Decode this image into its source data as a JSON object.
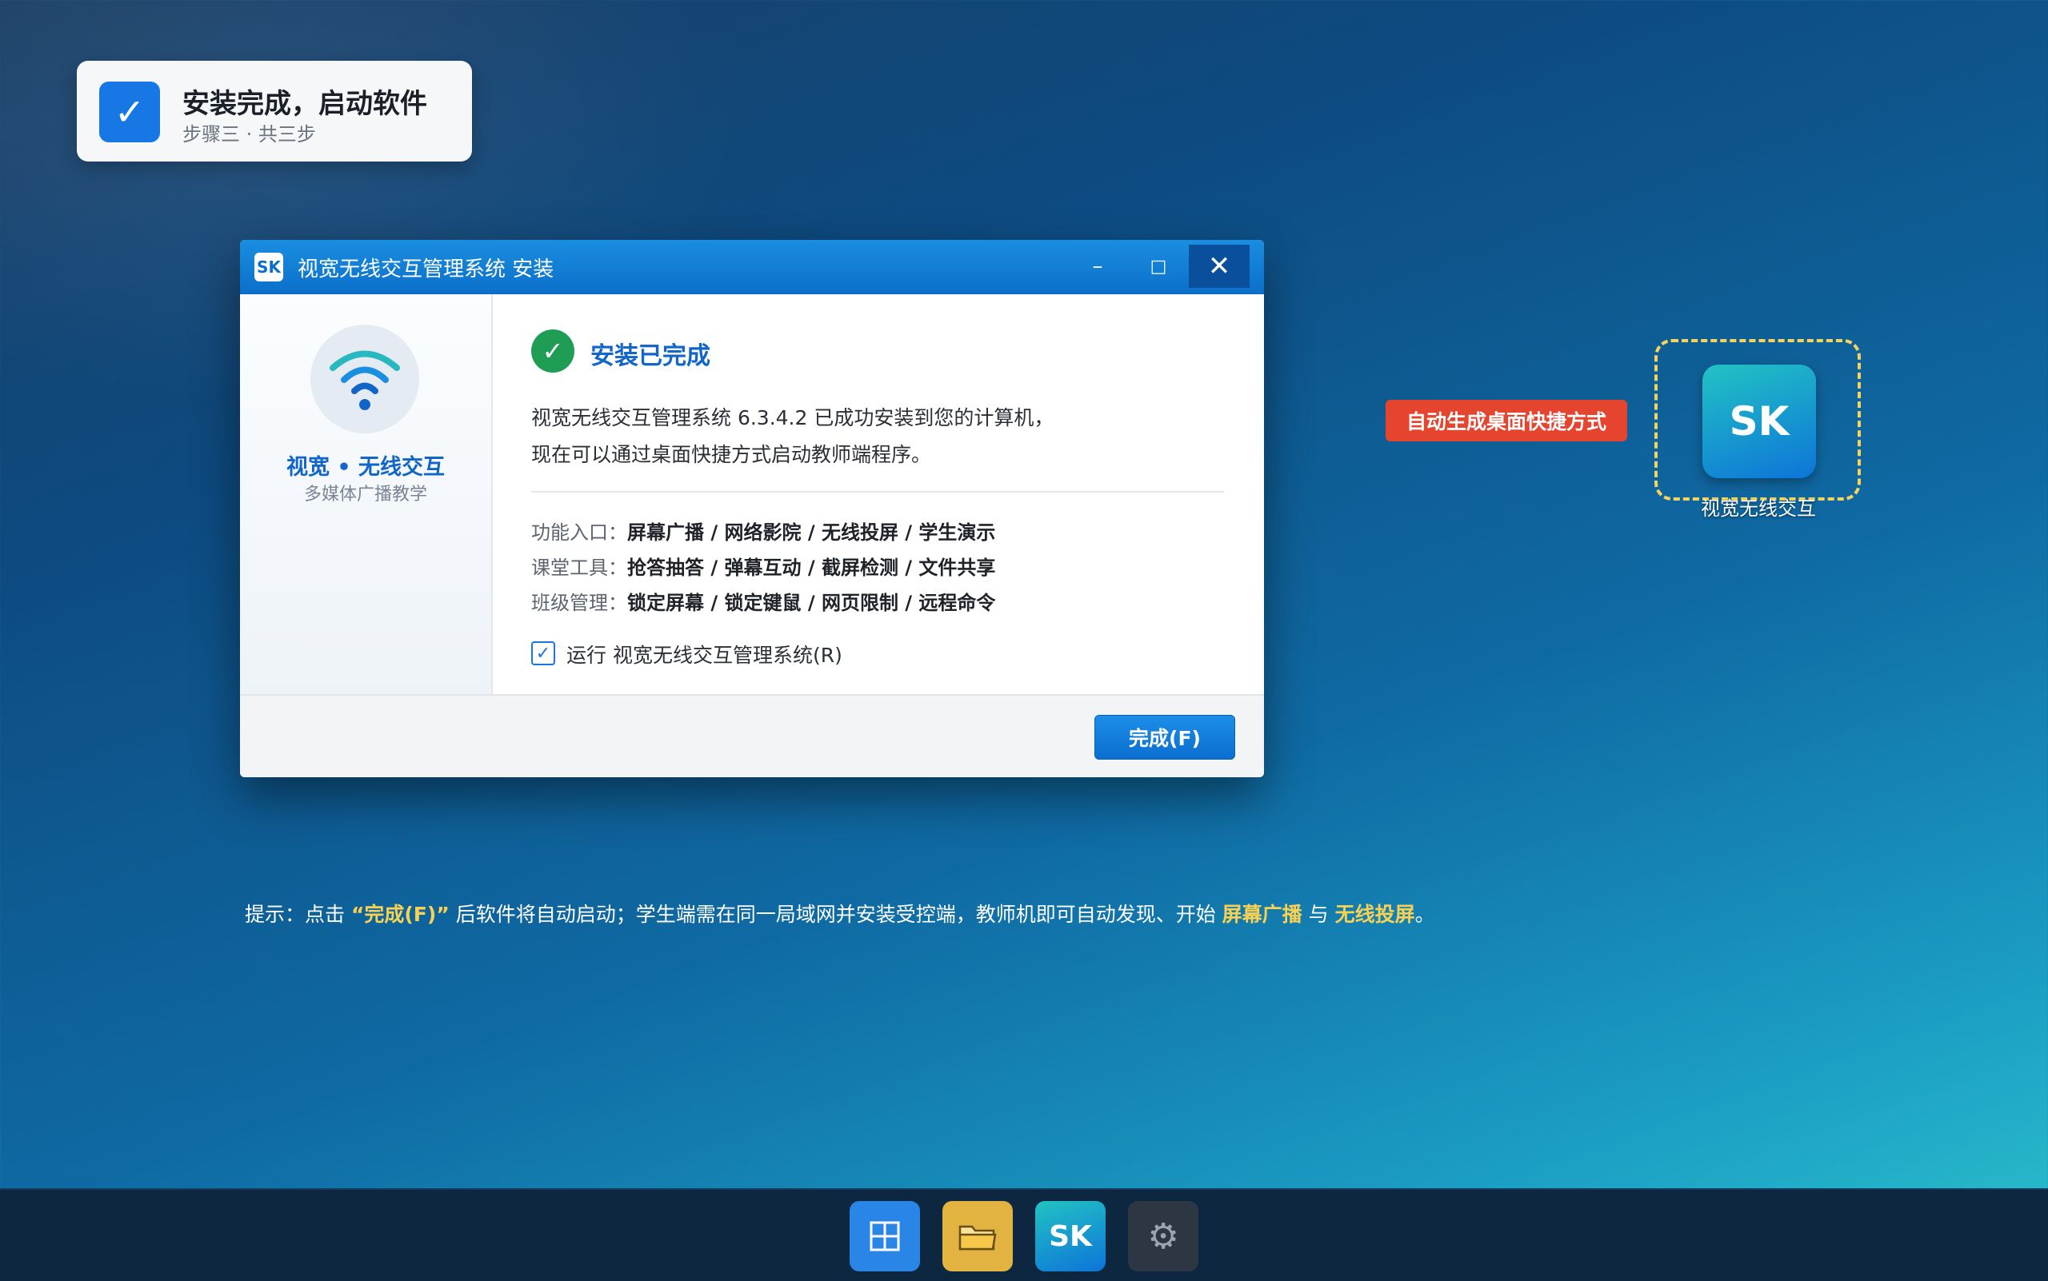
{
  "step_card": {
    "title": "安装完成，启动软件",
    "subtitle": "步骤三 · 共三步"
  },
  "window": {
    "logo": "SK",
    "title": "视宽无线交互管理系统 安装",
    "minimize": "–",
    "maximize": "□",
    "close": "✕",
    "sidebar": {
      "brand": "视宽 • 无线交互",
      "brand_sub": "多媒体广播教学"
    },
    "status_title": "安装已完成",
    "desc_line1": "视宽无线交互管理系统 6.3.4.2 已成功安装到您的计算机，",
    "desc_line2": "现在可以通过桌面快捷方式启动教师端程序。",
    "features": [
      {
        "label": "功能入口：",
        "value": "屏幕广播 / 网络影院 / 无线投屏 / 学生演示"
      },
      {
        "label": "课堂工具：",
        "value": "抢答抽答 / 弹幕互动 / 截屏检测 / 文件共享"
      },
      {
        "label": "班级管理：",
        "value": "锁定屏幕 / 锁定键鼠 / 网页限制 / 远程命令"
      }
    ],
    "run_checkbox_label": "运行 视宽无线交互管理系统(R)",
    "finish_button": "完成(F)"
  },
  "shortcut": {
    "tag": "自动生成桌面快捷方式",
    "icon_text": "SK",
    "label": "视宽无线交互"
  },
  "tip": {
    "prefix": "提示：点击 ",
    "hl1": "“完成(F)”",
    "mid1": " 后软件将自动启动；学生端需在同一局域网并安装受控端，教师机即可自动发现、开始 ",
    "hl2": "屏幕广播",
    "mid2": " 与 ",
    "hl3": "无线投屏",
    "suffix": "。"
  },
  "taskbar": {
    "sk_label": "SK",
    "settings_glyph": "⚙"
  },
  "colors": {
    "accent": "#1677e5",
    "success": "#1f9d55",
    "tag": "#e5452f",
    "highlight": "#f7d154"
  }
}
